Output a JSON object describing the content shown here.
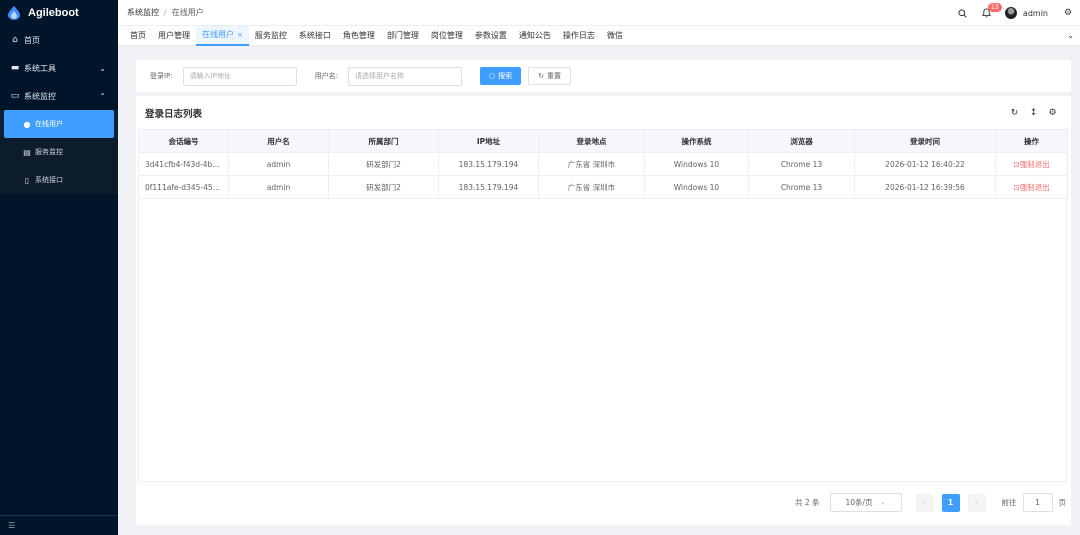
{
  "app": {
    "name": "Agileboot"
  },
  "sidebar": {
    "items": [
      {
        "label": "首页",
        "icon": "home-icon"
      },
      {
        "label": "系统工具",
        "icon": "toolbox-icon"
      },
      {
        "label": "系统监控",
        "icon": "monitor-icon"
      }
    ],
    "submenu": [
      {
        "label": "在线用户",
        "icon": "users-icon",
        "active": true
      },
      {
        "label": "服务监控",
        "icon": "server-icon"
      },
      {
        "label": "系统接口",
        "icon": "document-icon"
      }
    ]
  },
  "header": {
    "breadcrumb": [
      "系统监控",
      "在线用户"
    ],
    "notification_count": "13",
    "user": "admin"
  },
  "tabs": [
    {
      "label": "首页"
    },
    {
      "label": "用户管理"
    },
    {
      "label": "在线用户",
      "active": true
    },
    {
      "label": "服务监控"
    },
    {
      "label": "系统接口"
    },
    {
      "label": "角色管理"
    },
    {
      "label": "部门管理"
    },
    {
      "label": "岗位管理"
    },
    {
      "label": "参数设置"
    },
    {
      "label": "通知公告"
    },
    {
      "label": "操作日志"
    },
    {
      "label": "微信"
    }
  ],
  "search": {
    "ip_label": "登录IP:",
    "ip_placeholder": "请输入IP地址",
    "user_label": "用户名:",
    "user_placeholder": "请选择用户名称",
    "search_button": "搜索",
    "reset_button": "重置"
  },
  "table": {
    "title": "登录日志列表",
    "columns": [
      "会话编号",
      "用户名",
      "所属部门",
      "IP地址",
      "登录地点",
      "操作系统",
      "浏览器",
      "登录时间",
      "操作"
    ],
    "rows": [
      [
        "3d41cfb4-f43d-4b...",
        "admin",
        "研发部门2",
        "183.15.179.194",
        "广东省 深圳市",
        "Windows 10",
        "Chrome 13",
        "2026-01-12 16:40:22",
        "强制退出"
      ],
      [
        "0f111afe-d345-451...",
        "admin",
        "研发部门2",
        "183.15.179.194",
        "广东省 深圳市",
        "Windows 10",
        "Chrome 13",
        "2026-01-12 16:39:56",
        "强制退出"
      ]
    ]
  },
  "pagination": {
    "total": "共 2 条",
    "page_size": "10条/页",
    "current_page": "1",
    "jump_label": "前往",
    "jump_value": "1",
    "jump_unit": "页"
  },
  "colors": {
    "primary": "#409eff",
    "sidebar": "#001529",
    "danger": "#f56c6c"
  }
}
